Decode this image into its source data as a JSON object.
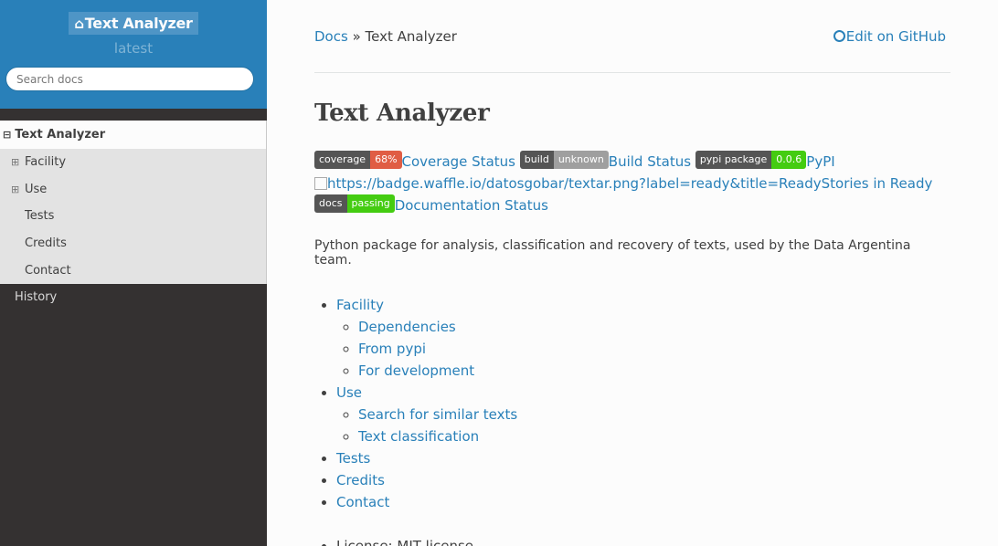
{
  "sidebar": {
    "project_title": "Text Analyzer",
    "home_icon": "home-icon",
    "version": "latest",
    "search_placeholder": "Search docs",
    "current_page": "Text Analyzer",
    "sub_items": [
      {
        "label": "Facility",
        "expandable": true
      },
      {
        "label": "Use",
        "expandable": true
      },
      {
        "label": "Tests",
        "expandable": false
      },
      {
        "label": "Credits",
        "expandable": false
      },
      {
        "label": "Contact",
        "expandable": false
      }
    ],
    "top_items": [
      "History"
    ]
  },
  "breadcrumbs": {
    "home": "Docs",
    "separator": "»",
    "current": "Text Analyzer",
    "edit_label": "Edit on GitHub",
    "edit_icon": "github-icon"
  },
  "page": {
    "title": "Text Analyzer",
    "badges": {
      "coverage": {
        "left": "coverage",
        "right": "68%",
        "link": "Coverage Status"
      },
      "build": {
        "left": "build",
        "right": "unknown",
        "link": "Build Status"
      },
      "pypi": {
        "left": "pypi package",
        "right": "0.0.6",
        "link": "PyPI"
      },
      "waffle": {
        "alt": "https://badge.waffle.io/datosgobar/textar.png?label=ready&title=Ready",
        "link": "Stories in Ready"
      },
      "docs": {
        "left": "docs",
        "right": "passing",
        "link": "Documentation Status"
      }
    },
    "description": "Python package for analysis, classification and recovery of texts, used by the Data Argentina team.",
    "toc": {
      "facility": "Facility",
      "dependencies": "Dependencies",
      "from_pypi": "From pypi",
      "for_development": "For development",
      "use": "Use",
      "search_similar": "Search for similar texts",
      "text_classification": "Text classification",
      "tests": "Tests",
      "credits": "Credits",
      "contact": "Contact"
    },
    "license": "License: MIT license"
  },
  "colors": {
    "accent": "#2980b9",
    "sidebar_bg": "#343131",
    "badge_red": "#e05d44",
    "badge_green": "#44cc11"
  }
}
